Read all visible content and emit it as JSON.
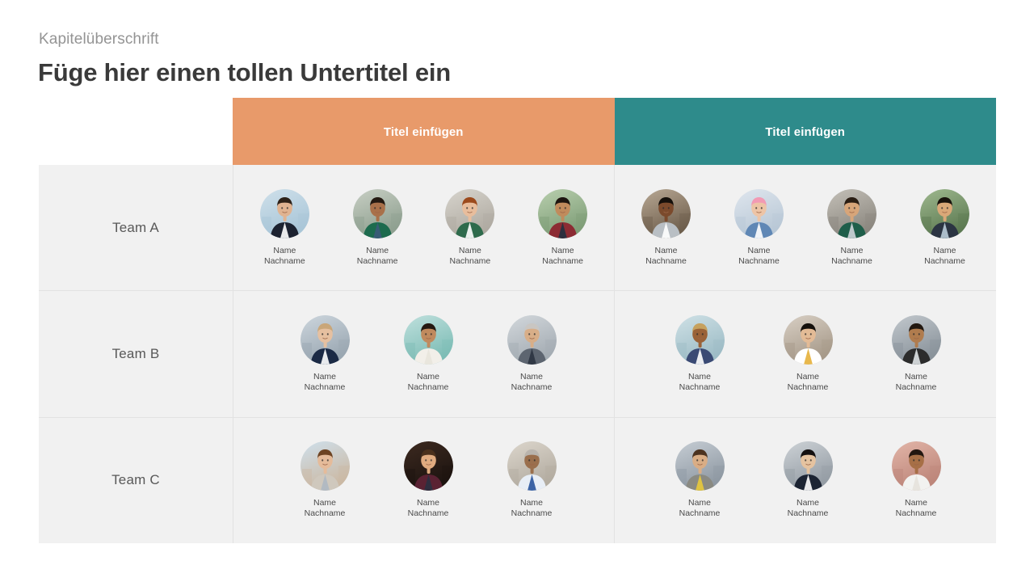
{
  "slide": {
    "eyebrow": "Kapitelüberschrift",
    "title": "Füge hier einen tollen Untertitel ein"
  },
  "colors": {
    "orange": "#e89a6a",
    "teal": "#2e8b8b",
    "cell_background": "#f1f1f1",
    "grid_line": "#e2e2e2",
    "eyebrow_text": "#949494",
    "title_text": "#3a3a3a",
    "row_label_text": "#585858",
    "person_name_text": "#4a4a4a",
    "header_text": "#ffffff"
  },
  "table": {
    "columns": [
      {
        "label": "Titel einfügen",
        "accent": "#e89a6a"
      },
      {
        "label": "Titel einfügen",
        "accent": "#2e8b8b"
      }
    ],
    "rows": [
      {
        "label": "Team A",
        "left": [
          {
            "name": "Name\nNachname"
          },
          {
            "name": "Name\nNachname"
          },
          {
            "name": "Name\nNachname"
          },
          {
            "name": "Name\nNachname"
          }
        ],
        "right": [
          {
            "name": "Name\nNachname"
          },
          {
            "name": "Name\nNachname"
          },
          {
            "name": "Name\nNachname"
          },
          {
            "name": "Name\nNachname"
          }
        ]
      },
      {
        "label": "Team B",
        "left": [
          {
            "name": "Name\nNachname"
          },
          {
            "name": "Name\nNachname"
          },
          {
            "name": "Name\nNachname"
          }
        ],
        "right": [
          {
            "name": "Name\nNachname"
          },
          {
            "name": "Name\nNachname"
          },
          {
            "name": "Name\nNachname"
          }
        ]
      },
      {
        "label": "Team C",
        "left": [
          {
            "name": "Name\nNachname"
          },
          {
            "name": "Name\nNachname"
          },
          {
            "name": "Name\nNachname"
          }
        ],
        "right": [
          {
            "name": "Name\nNachname"
          },
          {
            "name": "Name\nNachname"
          },
          {
            "name": "Name\nNachname"
          }
        ]
      }
    ]
  }
}
